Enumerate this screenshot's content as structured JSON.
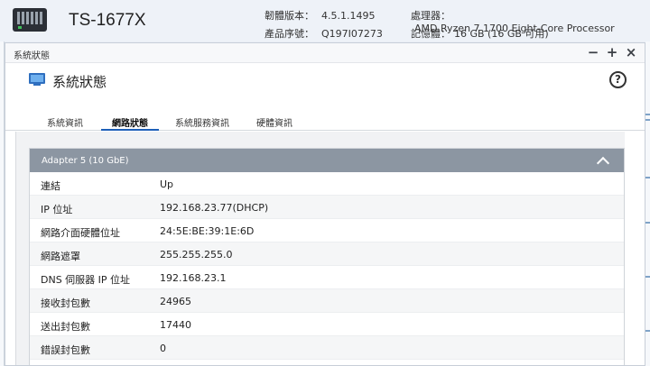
{
  "header": {
    "model": "TS-1677X",
    "firmware_label": "韌體版本：",
    "firmware_value": "4.5.1.1495",
    "serial_label": "產品序號：",
    "serial_value": "Q197I07273",
    "cpu_label": "處理器：",
    "cpu_value": "AMD Ryzen 7 1700 Eight-Core Processor",
    "memory_label": "記憶體：",
    "memory_value": "16 GB (16 GB 可用)"
  },
  "window": {
    "titlebar": "系統狀態",
    "minimize_glyph": "−",
    "maximize_glyph": "+",
    "close_glyph": "×",
    "app_title": "系統狀態",
    "help_glyph": "?"
  },
  "tabs": [
    {
      "label": "系統資訊"
    },
    {
      "label": "網路狀態"
    },
    {
      "label": "系統服務資訊"
    },
    {
      "label": "硬體資訊"
    }
  ],
  "active_tab": "網路狀態",
  "panel": {
    "title": "Adapter 5 (10 GbE)",
    "rows": [
      {
        "label": "連結",
        "value": "Up"
      },
      {
        "label": "IP 位址",
        "value": "192.168.23.77(DHCP)"
      },
      {
        "label": "網路介面硬體位址",
        "value": "24:5E:BE:39:1E:6D"
      },
      {
        "label": "網路遮罩",
        "value": "255.255.255.0"
      },
      {
        "label": "DNS 伺服器 IP 位址",
        "value": "192.168.23.1"
      },
      {
        "label": "接收封包數",
        "value": "24965"
      },
      {
        "label": "送出封包數",
        "value": "17440"
      },
      {
        "label": "錯誤封包數",
        "value": "0"
      }
    ]
  },
  "icons": {
    "app": "monitor-icon",
    "help": "help-circle-icon",
    "collapse": "chevron-up-icon",
    "device": "nas-device-icon"
  },
  "colors": {
    "accent": "#1d5fb8",
    "panel_header": "#8c96a2",
    "app_icon": "#2f6fbf"
  }
}
